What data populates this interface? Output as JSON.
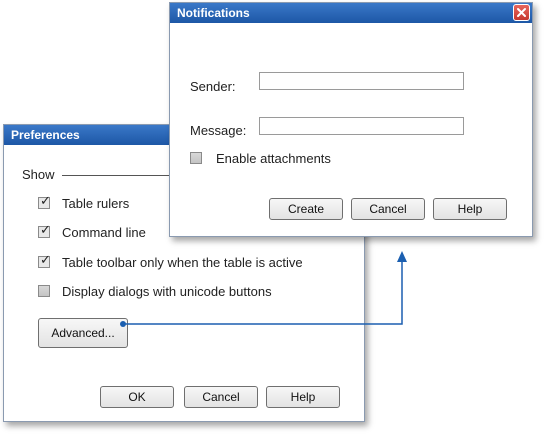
{
  "preferences": {
    "title": "Preferences",
    "section_label": "Show",
    "checkboxes": [
      {
        "label": "Table rulers",
        "checked": true
      },
      {
        "label": "Command line",
        "checked": true
      },
      {
        "label": "Table toolbar only when the table is active",
        "checked": true
      },
      {
        "label": "Display dialogs with unicode buttons",
        "checked": false
      }
    ],
    "advanced_label": "Advanced...",
    "ok_label": "OK",
    "cancel_label": "Cancel",
    "help_label": "Help"
  },
  "notifications": {
    "title": "Notifications",
    "sender_label": "Sender:",
    "sender_value": "",
    "message_label": "Message:",
    "message_value": "",
    "attachments_label": "Enable attachments",
    "attachments_checked": false,
    "create_label": "Create",
    "cancel_label": "Cancel",
    "help_label": "Help"
  },
  "colors": {
    "titlebar": "#1d57a6",
    "connector": "#1b5fb0",
    "close_button": "#d9453a"
  }
}
